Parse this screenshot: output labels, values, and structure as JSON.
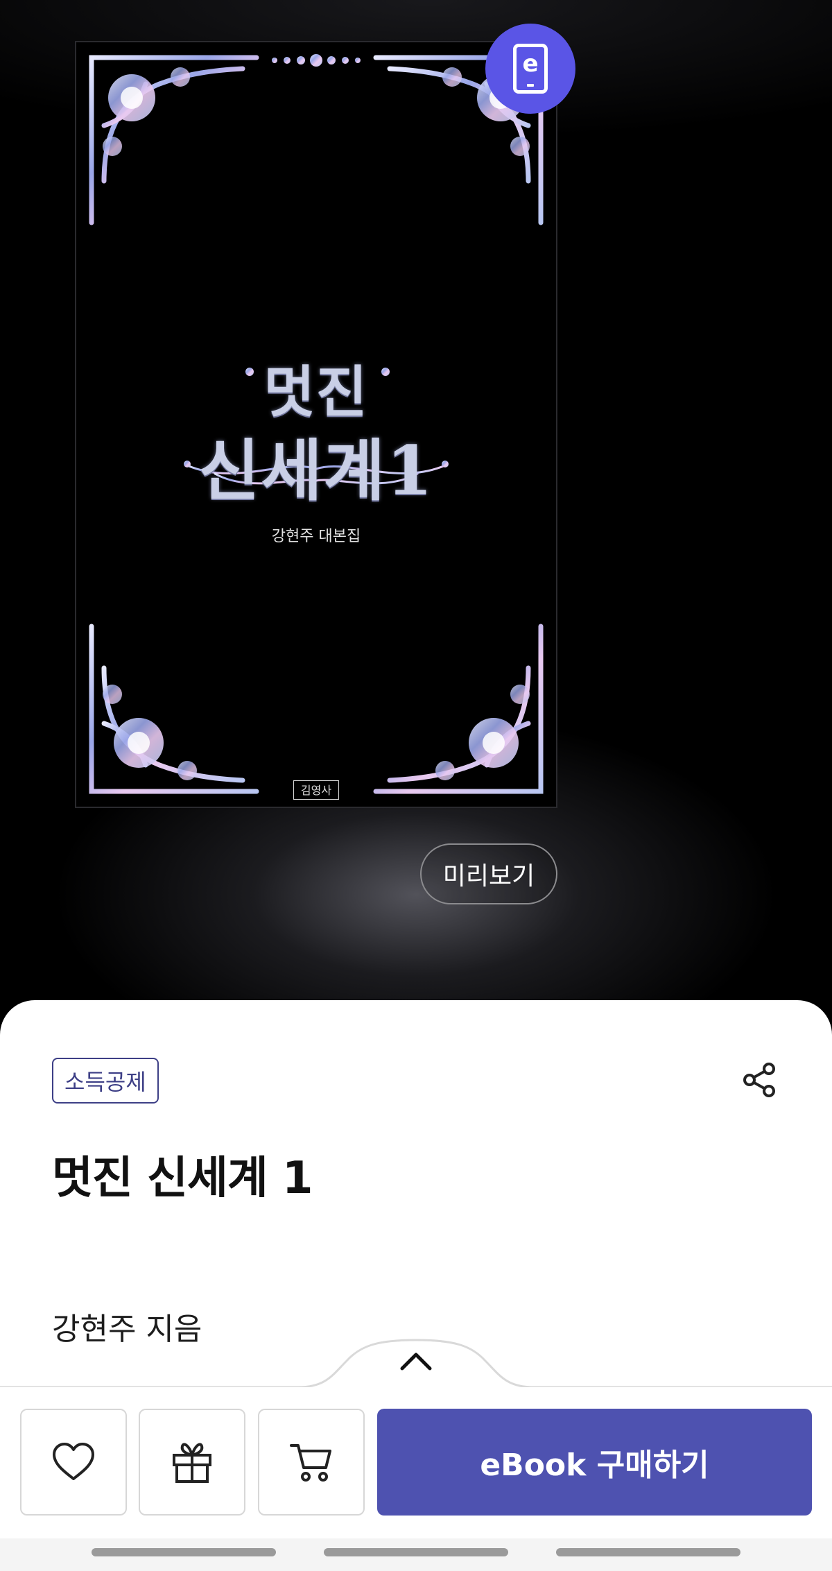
{
  "cover": {
    "title_line1": "멋진",
    "title_line2": "신세계1",
    "subtitle": "강현주 대본집",
    "publisher": "김영사"
  },
  "ebook_badge": {
    "letter": "e",
    "color": "#5a55e6"
  },
  "preview_button": {
    "label": "미리보기"
  },
  "product": {
    "tag": "소득공제",
    "title": "멋진 신세계 1",
    "author": "강현주 지음"
  },
  "actions": {
    "buy_label": "eBook 구매하기",
    "buy_color": "#4e52b0",
    "icons": [
      "heart-icon",
      "gift-icon",
      "cart-icon",
      "share-icon",
      "chevron-up-icon"
    ]
  }
}
